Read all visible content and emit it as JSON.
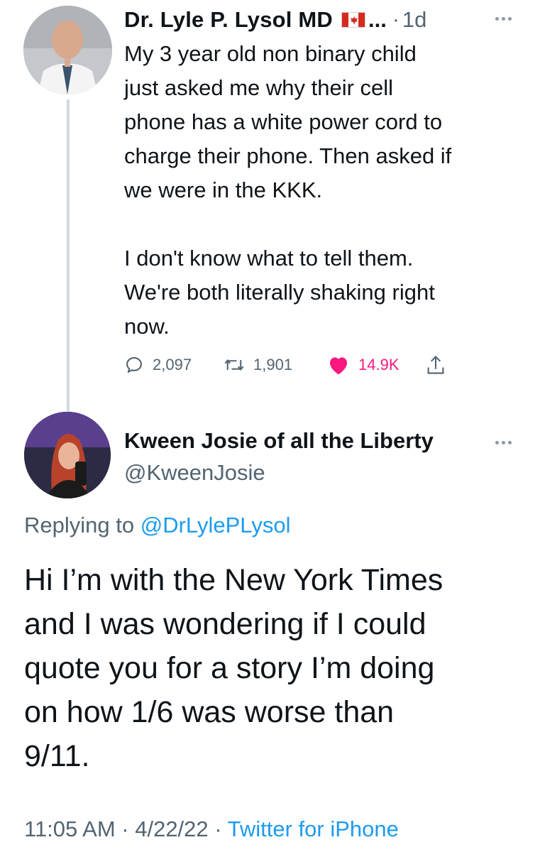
{
  "parent_tweet": {
    "author_name": "Dr. Lyle P. Lysol MD",
    "flag_icon": "canada-flag",
    "ellipsis": "...",
    "separator": "·",
    "time": "1d",
    "text": "My 3 year old non binary child\njust asked me why their cell\nphone has a white power cord to\ncharge their phone. Then asked if\nwe were in the KKK.\n\nI don't know what to tell them.\nWe're both literally shaking right\nnow.",
    "replies": "2,097",
    "retweets": "1,901",
    "likes": "14.9K",
    "liked": true,
    "like_color": "#f91880"
  },
  "reply_tweet": {
    "author_name": "Kween Josie of all the Liberty",
    "handle": "@KweenJosie",
    "replying_to_prefix": "Replying to ",
    "replying_to_handle": "@DrLylePLysol",
    "text": "Hi I’m with the New York Times\nand I was wondering if I could\nquote you for a story I’m doing\non how 1/6 was worse than\n9/11.",
    "timestamp": "11:05 AM · 4/22/22 · ",
    "source": "Twitter for iPhone"
  },
  "colors": {
    "text_primary": "#0f1419",
    "text_secondary": "#536471",
    "link": "#1d9bf0",
    "thread_line": "#cfd9de"
  }
}
